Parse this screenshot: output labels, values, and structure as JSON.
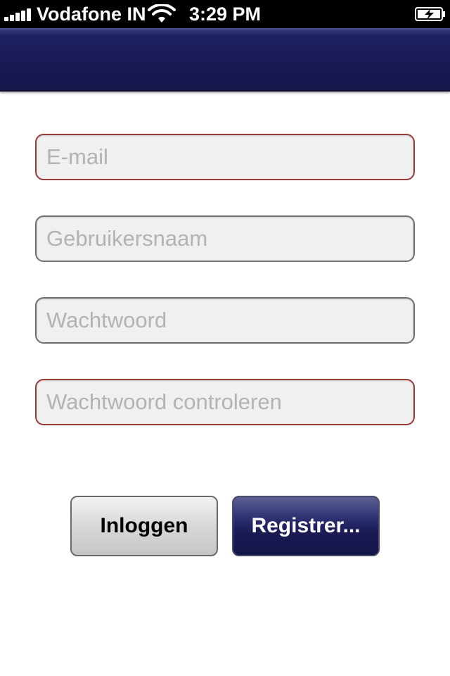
{
  "status_bar": {
    "carrier": "Vodafone IN",
    "time": "3:29 PM",
    "signal_bars": 5,
    "icons": [
      "signal-bars-icon",
      "wifi-icon",
      "battery-charging-icon"
    ]
  },
  "nav_bar": {
    "title": ""
  },
  "form": {
    "email": {
      "placeholder": "E-mail",
      "value": "",
      "state": "invalid"
    },
    "username": {
      "placeholder": "Gebruikersnaam",
      "value": "",
      "state": "normal"
    },
    "password": {
      "placeholder": "Wachtwoord",
      "value": "",
      "state": "normal"
    },
    "password_confirm": {
      "placeholder": "Wachtwoord controleren",
      "value": "",
      "state": "invalid"
    }
  },
  "buttons": {
    "login_label": "Inloggen",
    "register_label": "Registrer..."
  },
  "colors": {
    "nav_bar": "#1a1a55",
    "field_background": "#f0f0f0",
    "field_border": "#6e6e6e",
    "field_border_invalid": "#9a3b3b",
    "register_button": "#1a1b55",
    "login_button": "#d8d8d8"
  }
}
